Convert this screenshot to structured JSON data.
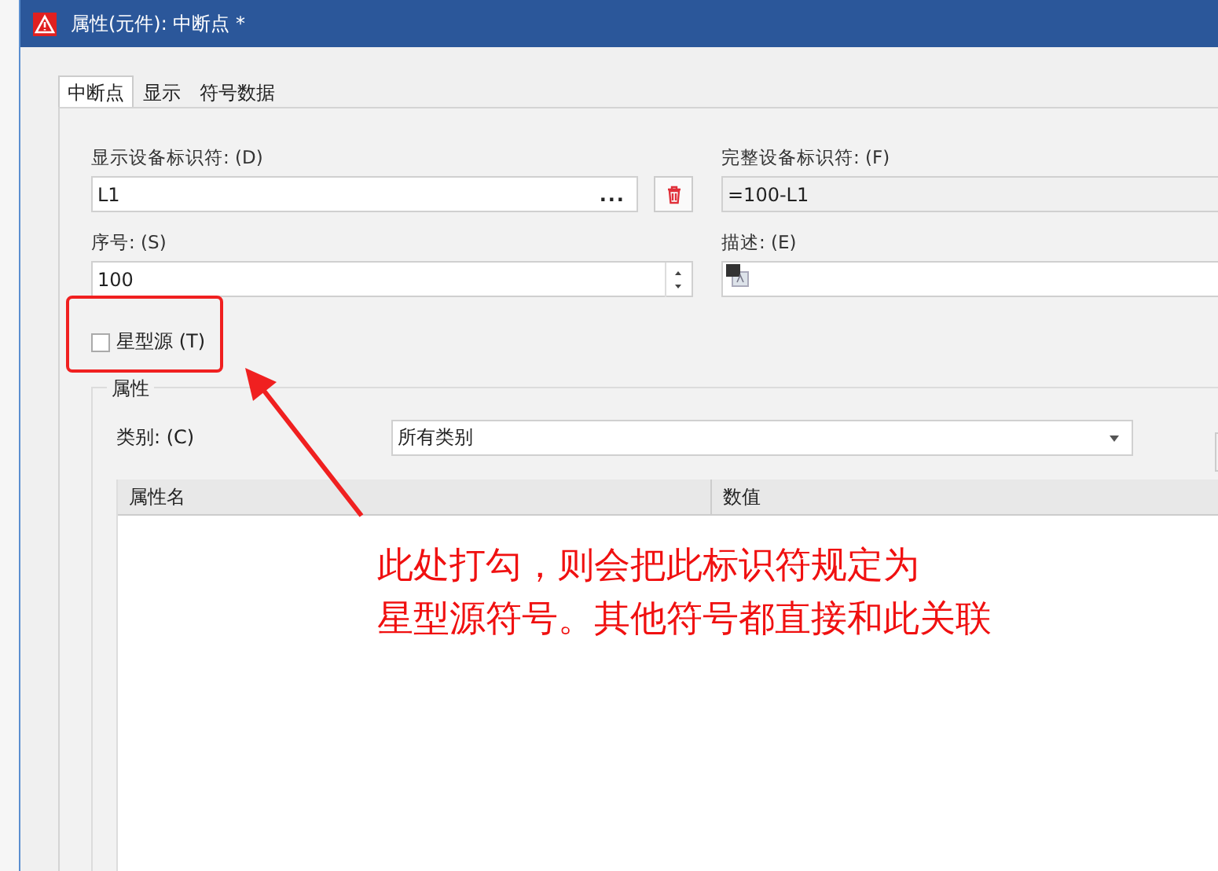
{
  "window": {
    "title": "属性(元件): 中断点 *"
  },
  "tabs": [
    {
      "label": "中断点",
      "selected": true
    },
    {
      "label": "显示",
      "selected": false
    },
    {
      "label": "符号数据",
      "selected": false
    }
  ],
  "display_id": {
    "label": "显示设备标识符: (D)",
    "value": "L1",
    "more": "..."
  },
  "full_id": {
    "label": "完整设备标识符: (F)",
    "value": "=100-L1"
  },
  "sequence": {
    "label": "序号: (S)",
    "value": "100"
  },
  "description": {
    "label": "描述: (E)"
  },
  "star_source": {
    "label": "星型源 (T)",
    "checked": false
  },
  "properties": {
    "title": "属性",
    "category_label": "类别: (C)",
    "category_value": "所有类别",
    "columns": [
      "属性名",
      "数值"
    ]
  },
  "annotation": {
    "lines": [
      "此处打勾，则会把此标识符规定为",
      "星型源符号。其他符号都直接和此关联"
    ]
  }
}
